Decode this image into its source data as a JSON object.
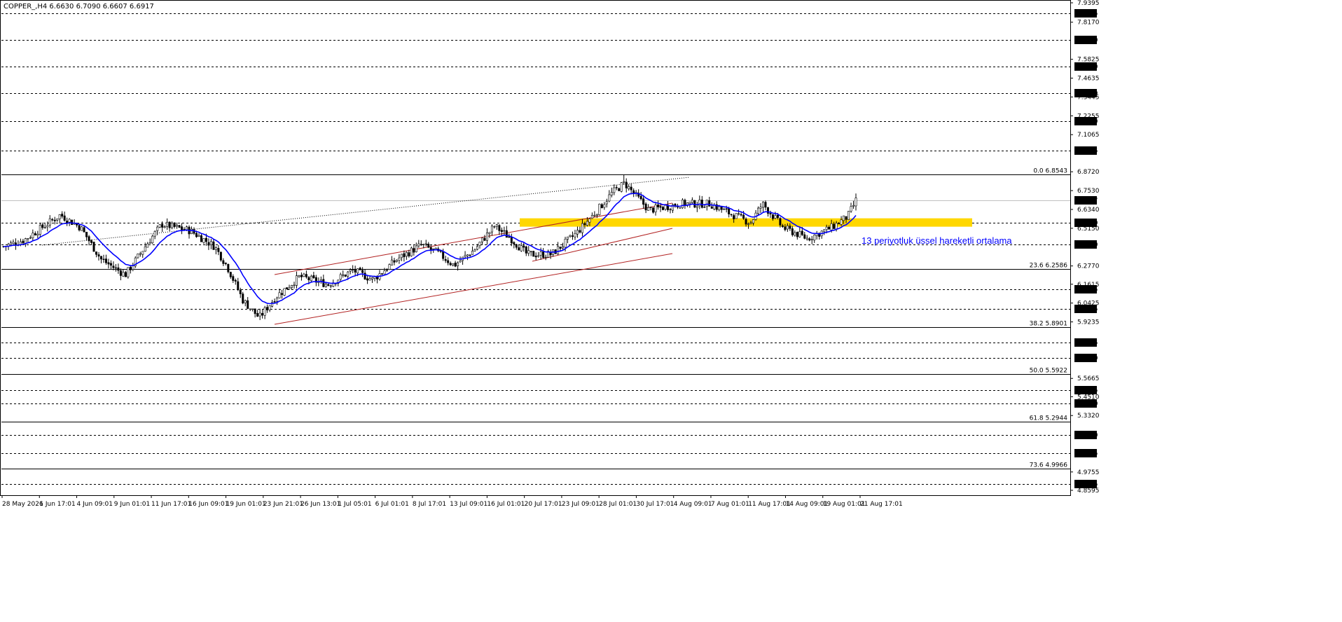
{
  "header": {
    "symbol": "COPPER_,H4",
    "ohlc": "6.6630 6.7090 6.6607 6.6917"
  },
  "chart_data": {
    "type": "candlestick",
    "symbol": "COPPER_",
    "timeframe": "H4",
    "current_price": "6.6917",
    "price_range": [
      4.8595,
      7.9395
    ],
    "price_axis_ticks": [
      "7.9395",
      "7.8170",
      "7.5825",
      "7.4635",
      "7.3445",
      "7.2255",
      "7.1065",
      "6.8720",
      "6.7530",
      "6.6340",
      "6.5150",
      "6.2770",
      "6.1615",
      "6.0425",
      "5.9235",
      "5.5665",
      "5.4510",
      "5.3320",
      "4.9755",
      "4.8595"
    ],
    "time_labels": [
      "28 May 2026",
      "1 Jun 17:01",
      "4 Jun 09:01",
      "9 Jun 01:01",
      "11 Jun 17:01",
      "16 Jun 09:01",
      "19 Jun 01:01",
      "23 Jun 21:01",
      "26 Jun 13:01",
      "1 Jul 05:01",
      "6 Jul 01:01",
      "8 Jul 17:01",
      "13 Jul 09:01",
      "16 Jul 01:01",
      "20 Jul 17:01",
      "23 Jul 09:01",
      "28 Jul 01:01",
      "30 Jul 17:01",
      "4 Aug 09:01",
      "7 Aug 01:01",
      "11 Aug 17:01",
      "14 Aug 09:01",
      "19 Aug 01:01",
      "21 Aug 17:01"
    ],
    "horizontal_levels": [
      {
        "price": 7.8745,
        "label": "7.8745",
        "style": "dashed"
      },
      {
        "price": 7.706,
        "label": "7.7060",
        "style": "dashed"
      },
      {
        "price": 7.535,
        "label": "7.5350",
        "style": "dashed"
      },
      {
        "price": 7.368,
        "label": "7.3680",
        "style": "dashed"
      },
      {
        "price": 7.191,
        "label": "7.1910",
        "style": "dashed"
      },
      {
        "price": 7.0045,
        "label": "7.0045",
        "style": "dashed"
      },
      {
        "price": 6.552,
        "label": "6.5520",
        "style": "dashed"
      },
      {
        "price": 6.413,
        "label": "6.4130",
        "style": "dashed"
      },
      {
        "price": 6.1305,
        "label": "6.1305",
        "style": "dashed"
      },
      {
        "price": 6.0075,
        "label": "6.0075",
        "style": "dashed"
      },
      {
        "price": 5.7935,
        "label": "5.7935",
        "style": "dashed"
      },
      {
        "price": 5.696,
        "label": "5.6960",
        "style": "dashed"
      },
      {
        "price": 5.4905,
        "label": "5.4905",
        "style": "dashed"
      },
      {
        "price": 5.409,
        "label": "5.4090",
        "style": "dashed"
      },
      {
        "price": 5.21,
        "label": "5.2100",
        "style": "dashed"
      },
      {
        "price": 5.0925,
        "label": "5.0925",
        "style": "dashed"
      },
      {
        "price": 4.8985,
        "label": "4.8985",
        "style": "dashed"
      }
    ],
    "fibonacci_levels": [
      {
        "ratio": "0.0",
        "price": "6.8543"
      },
      {
        "ratio": "23.6",
        "price": "6.2586"
      },
      {
        "ratio": "38.2",
        "price": "5.8901"
      },
      {
        "ratio": "50.0",
        "price": "5.5922"
      },
      {
        "ratio": "61.8",
        "price": "5.2944"
      },
      {
        "ratio": "73.6",
        "price": "4.9966"
      }
    ],
    "support_zone": {
      "from": 6.525,
      "to": 6.578,
      "color": "#ffd700"
    },
    "ema_label": "13 periyotluk üssel hareketli ortalama",
    "ema_period": 13,
    "candle_count": 350,
    "ohlc": [],
    "colors": {
      "candle": "#000000",
      "ema": "#0000ff",
      "channel": "#b22222",
      "zone": "#ffd700",
      "annotation": "#0000ff",
      "price_box": "#000000"
    }
  }
}
